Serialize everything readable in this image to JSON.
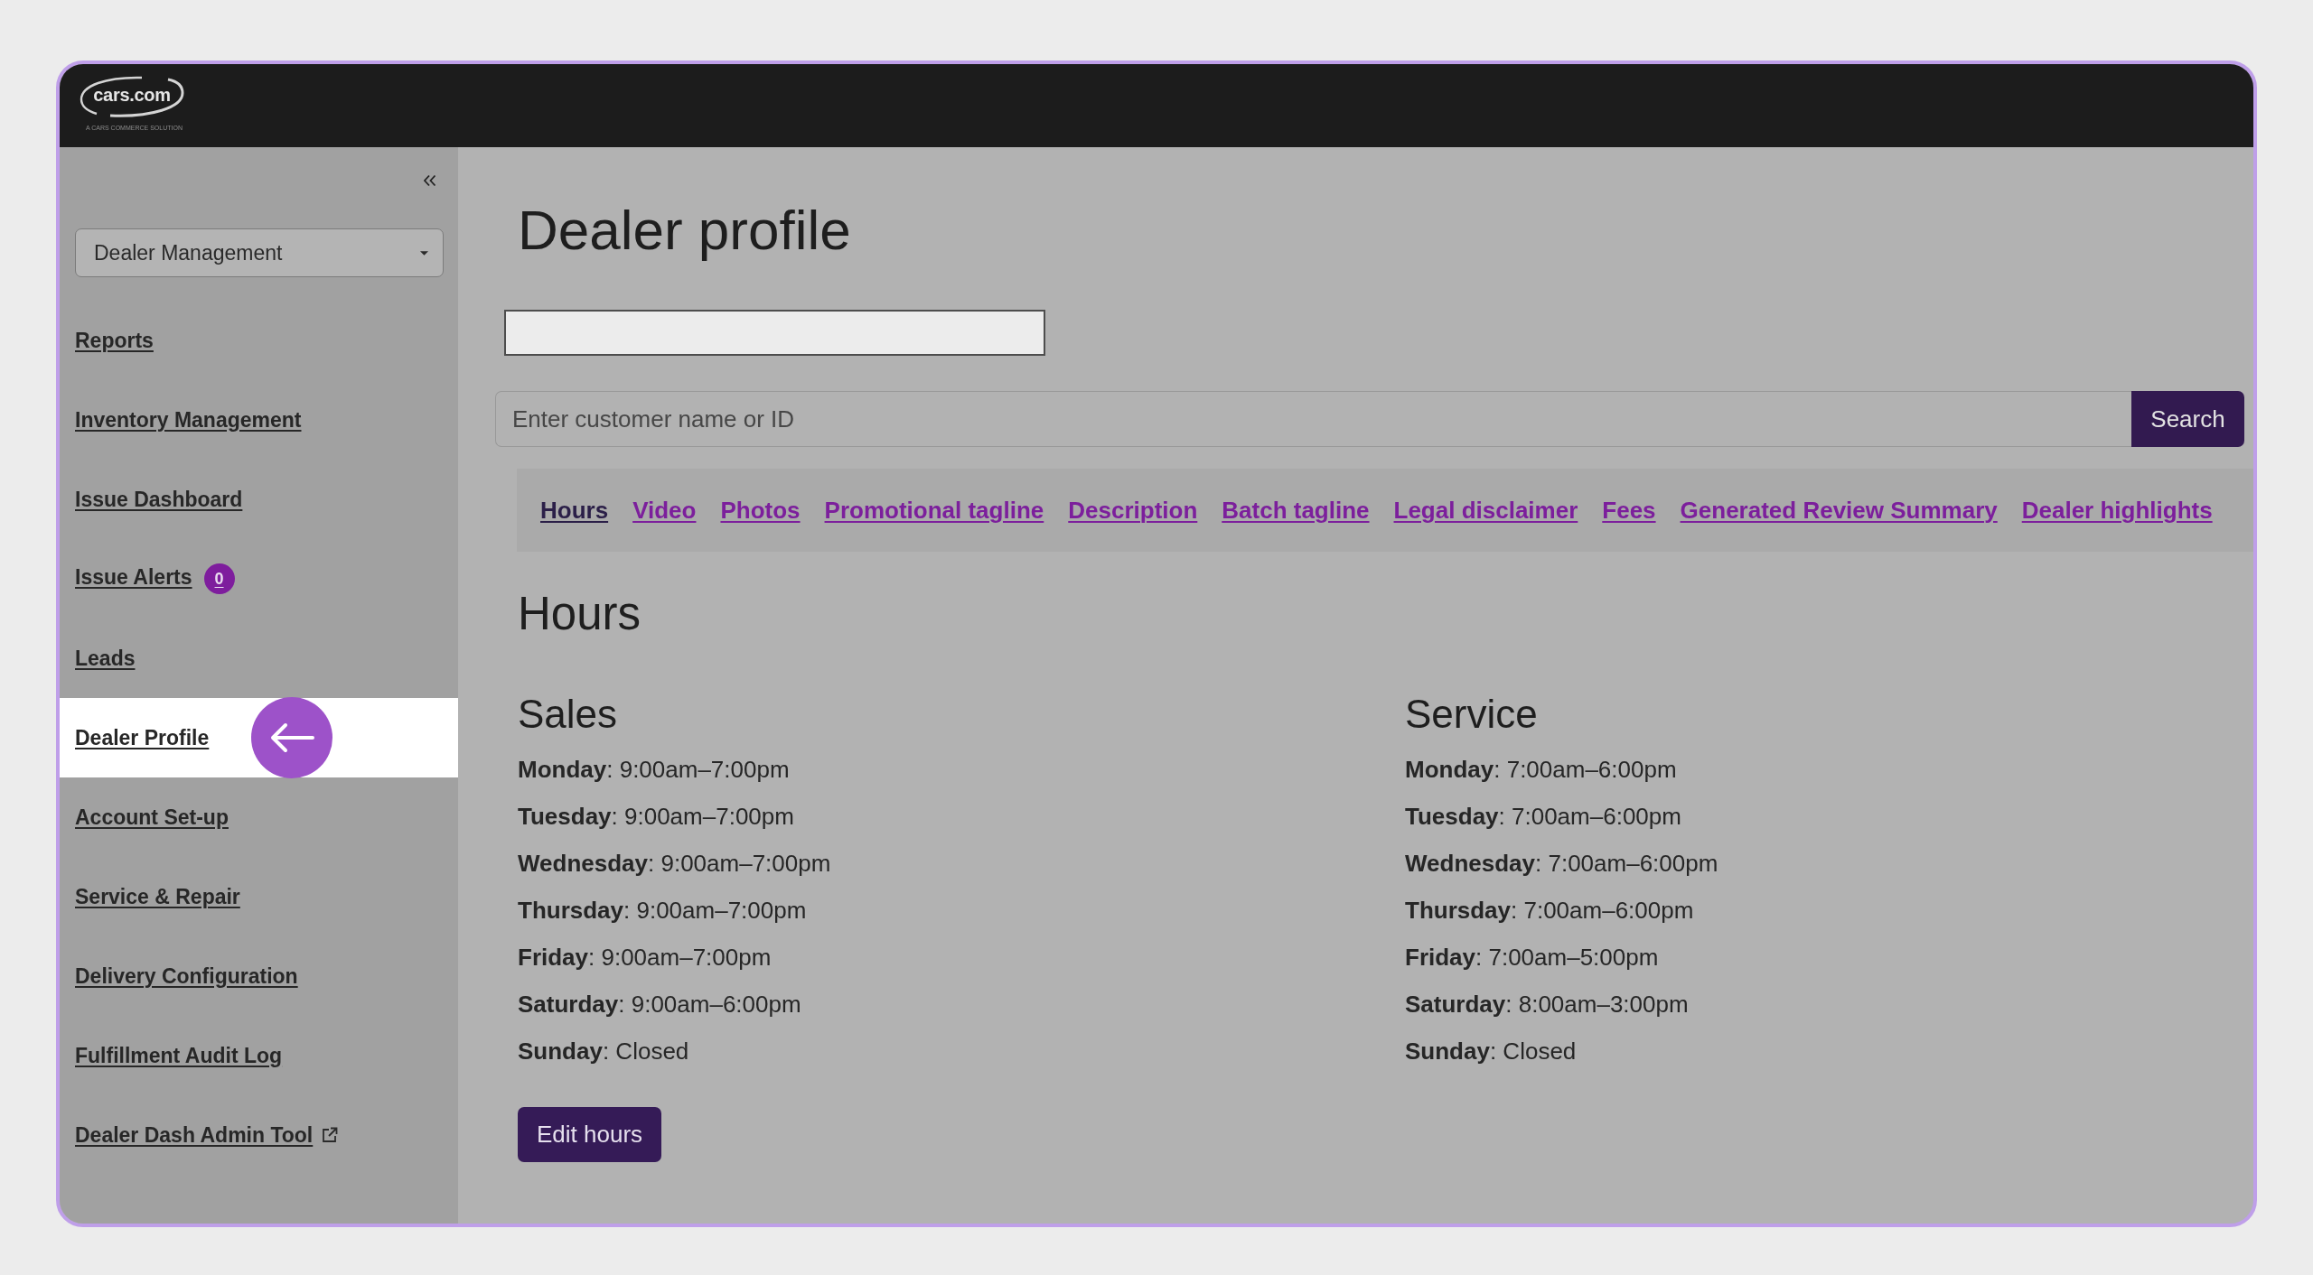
{
  "header": {
    "logo": {
      "wordmark": "cars.com",
      "tagline": "A CARS COMMERCE SOLUTION"
    }
  },
  "sidebar": {
    "dropdown": {
      "value": "Dealer Management"
    },
    "items": [
      {
        "label": "Reports",
        "selected": false,
        "external": false
      },
      {
        "label": "Inventory Management",
        "selected": false,
        "external": false
      },
      {
        "label": "Issue Dashboard",
        "selected": false,
        "external": false
      },
      {
        "label": "Issue Alerts",
        "selected": false,
        "external": false,
        "badge": "0"
      },
      {
        "label": "Leads",
        "selected": false,
        "external": false
      },
      {
        "label": "Dealer Profile",
        "selected": true,
        "external": false
      },
      {
        "label": "Account Set-up",
        "selected": false,
        "external": false
      },
      {
        "label": "Service & Repair",
        "selected": false,
        "external": false
      },
      {
        "label": "Delivery Configuration",
        "selected": false,
        "external": false
      },
      {
        "label": "Fulfillment Audit Log",
        "selected": false,
        "external": false
      },
      {
        "label": "Dealer Dash Admin Tool",
        "selected": false,
        "external": true
      }
    ]
  },
  "main": {
    "title": "Dealer profile",
    "search": {
      "placeholder": "Enter customer name or ID",
      "button": "Search"
    },
    "tabs": [
      {
        "label": "Hours",
        "selected": true
      },
      {
        "label": "Video",
        "selected": false
      },
      {
        "label": "Photos",
        "selected": false
      },
      {
        "label": "Promotional tagline",
        "selected": false
      },
      {
        "label": "Description",
        "selected": false
      },
      {
        "label": "Batch tagline",
        "selected": false
      },
      {
        "label": "Legal disclaimer",
        "selected": false
      },
      {
        "label": "Fees",
        "selected": false
      },
      {
        "label": "Generated Review Summary",
        "selected": false
      },
      {
        "label": "Dealer highlights",
        "selected": false
      }
    ],
    "section_title": "Hours",
    "schedules": [
      {
        "title": "Sales",
        "lines": [
          "**Monday**: 9:00am–7:00pm",
          "**Tuesday**: 9:00am–7:00pm",
          "**Wednesday**: 9:00am–7:00pm",
          "**Thursday**: 9:00am–7:00pm",
          "**Friday**: 9:00am–7:00pm",
          "**Saturday**: 9:00am–6:00pm",
          "**Sunday**: Closed"
        ]
      },
      {
        "title": "Service",
        "lines": [
          "**Monday**: 7:00am–6:00pm",
          "**Tuesday**: 7:00am–6:00pm",
          "**Wednesday**: 7:00am–6:00pm",
          "**Thursday**: 7:00am–6:00pm",
          "**Friday**: 7:00am–5:00pm",
          "**Saturday**: 8:00am–3:00pm",
          "**Sunday**: Closed"
        ]
      }
    ],
    "edit_button": "Edit hours"
  }
}
